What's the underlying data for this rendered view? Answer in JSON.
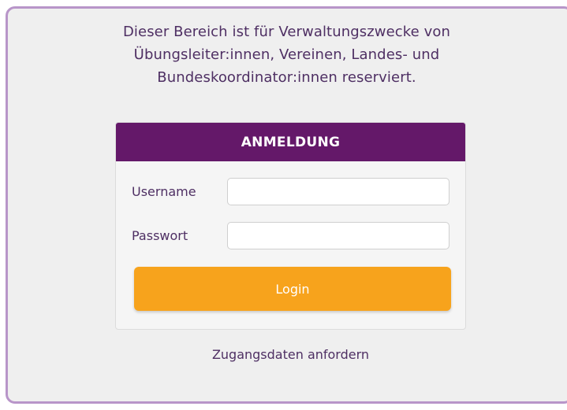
{
  "intro": {
    "line1": "Dieser Bereich ist für Verwaltungszwecke von",
    "line2": "Übungsleiter:innen, Vereinen, Landes- und",
    "line3": "Bundeskoordinator:innen reserviert."
  },
  "login_panel": {
    "title": "ANMELDUNG",
    "username_label": "Username",
    "username_value": "",
    "password_label": "Passwort",
    "password_value": "",
    "login_button": "Login"
  },
  "request_access_link": "Zugangsdaten anfordern",
  "colors": {
    "header": "#641869",
    "button": "#f7a31c",
    "text": "#4e2f63",
    "border": "#b895c9"
  }
}
